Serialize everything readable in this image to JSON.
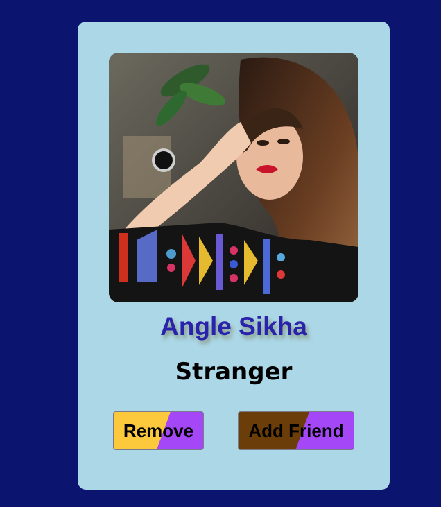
{
  "profile": {
    "name": "Angle Sikha",
    "status": "Stranger",
    "photo_alt": "Profile photo"
  },
  "actions": {
    "remove_label": "Remove",
    "add_friend_label": "Add Friend"
  },
  "colors": {
    "page_background": "#0b1570",
    "card_background": "#acd7e6",
    "name_color": "#2a22aa",
    "remove_button_primary": "#fcc93d",
    "add_button_primary": "#6b3d08",
    "button_accent": "#a447f7"
  }
}
